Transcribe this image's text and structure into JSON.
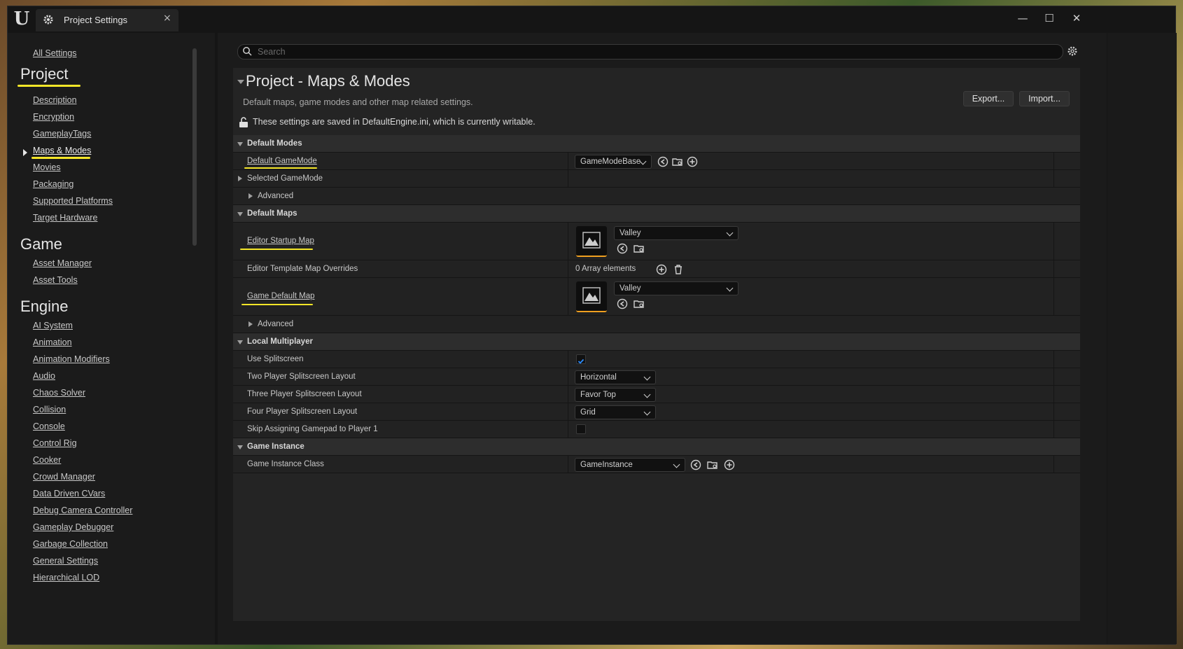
{
  "window": {
    "tab_title": "Project Settings",
    "tab_close": "×",
    "logo": "U",
    "controls": {
      "minimize": "—",
      "maximize": "☐",
      "close": "✕"
    }
  },
  "sidebar": {
    "all_settings": "All Settings",
    "sections": [
      {
        "heading": "Project",
        "items": [
          "Description",
          "Encryption",
          "GameplayTags",
          "Maps & Modes",
          "Movies",
          "Packaging",
          "Supported Platforms",
          "Target Hardware"
        ]
      },
      {
        "heading": "Game",
        "items": [
          "Asset Manager",
          "Asset Tools"
        ]
      },
      {
        "heading": "Engine",
        "items": [
          "AI System",
          "Animation",
          "Animation Modifiers",
          "Audio",
          "Chaos Solver",
          "Collision",
          "Console",
          "Control Rig",
          "Cooker",
          "Crowd Manager",
          "Data Driven CVars",
          "Debug Camera Controller",
          "Gameplay Debugger",
          "Garbage Collection",
          "General Settings",
          "Hierarchical LOD"
        ]
      }
    ],
    "selected": "Maps & Modes"
  },
  "search": {
    "placeholder": "Search",
    "value": ""
  },
  "header": {
    "title": "Project - Maps & Modes",
    "description": "Default maps, game modes and other map related settings.",
    "writable_note": "These settings are saved in DefaultEngine.ini, which is currently writable.",
    "export_label": "Export...",
    "import_label": "Import..."
  },
  "categories": {
    "default_modes": "Default Modes",
    "default_maps": "Default Maps",
    "local_multiplayer": "Local Multiplayer",
    "game_instance": "Game Instance"
  },
  "props": {
    "default_gamemode": {
      "label": "Default GameMode",
      "value": "GameModeBase"
    },
    "selected_gamemode": {
      "label": "Selected GameMode"
    },
    "advanced": "Advanced",
    "editor_startup_map": {
      "label": "Editor Startup Map",
      "value": "Valley"
    },
    "editor_template_overrides": {
      "label": "Editor Template Map Overrides",
      "value": "0 Array elements"
    },
    "game_default_map": {
      "label": "Game Default Map",
      "value": "Valley"
    },
    "use_splitscreen": {
      "label": "Use Splitscreen",
      "checked": true
    },
    "two_player_layout": {
      "label": "Two Player Splitscreen Layout",
      "value": "Horizontal"
    },
    "three_player_layout": {
      "label": "Three Player Splitscreen Layout",
      "value": "Favor Top"
    },
    "four_player_layout": {
      "label": "Four Player Splitscreen Layout",
      "value": "Grid"
    },
    "skip_gamepad": {
      "label": "Skip Assigning Gamepad to Player 1",
      "checked": false
    },
    "game_instance_class": {
      "label": "Game Instance Class",
      "value": "GameInstance"
    }
  },
  "colors": {
    "highlight": "#f4e628",
    "accent": "#f0a020",
    "check": "#2a8cff"
  }
}
